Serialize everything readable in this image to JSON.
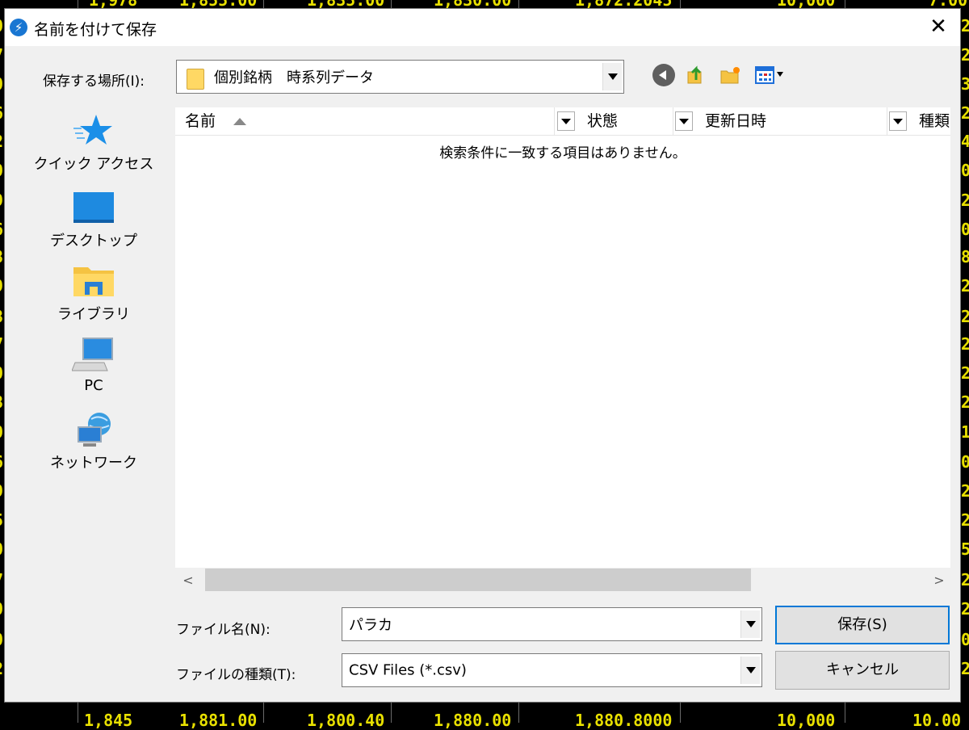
{
  "background": {
    "top_row": [
      "1,978",
      "1,855.00",
      "1,835.00",
      "1,830.00",
      "1,872.2045",
      "10,000",
      "7.00"
    ],
    "bottom_row": [
      "1,845",
      "1,881.00",
      "1,800.40",
      "1,880.00",
      "1,880.8000",
      "10,000",
      "10.00"
    ],
    "left_digits": [
      "0",
      "7",
      "0",
      "6",
      "2",
      "0",
      "9",
      "6",
      "8",
      "9",
      "8",
      "7",
      "0",
      "8",
      "0",
      "6",
      "9",
      "5",
      "0",
      "7",
      "0",
      "0",
      "2"
    ],
    "right_digits": [
      "2",
      "2",
      "3",
      "2",
      "4",
      "0",
      "2",
      "0",
      "8",
      "2",
      "2",
      "2",
      "2",
      "2",
      "1",
      "0",
      "2",
      "2",
      "5",
      "2",
      "2",
      "0",
      "2"
    ],
    "number_color": "#e8e000"
  },
  "dialog": {
    "title": "名前を付けて保存",
    "close_glyph": "✕",
    "location_label": "保存する場所(I):",
    "location_value": "個別銘柄　時系列データ",
    "places": [
      {
        "label": "クイック アクセス",
        "icon": "star-icon"
      },
      {
        "label": "デスクトップ",
        "icon": "desktop-icon"
      },
      {
        "label": "ライブラリ",
        "icon": "library-icon"
      },
      {
        "label": "PC",
        "icon": "pc-icon"
      },
      {
        "label": "ネットワーク",
        "icon": "network-icon"
      }
    ],
    "columns": [
      "名前",
      "状態",
      "更新日時",
      "種類"
    ],
    "empty_message": "検索条件に一致する項目はありません。",
    "filename_label": "ファイル名(N):",
    "filename_value": "パラカ",
    "filetype_label": "ファイルの種類(T):",
    "filetype_value": "CSV Files (*.csv)",
    "save_button": "保存(S)",
    "cancel_button": "キャンセル",
    "scroll_left": "<",
    "scroll_right": ">",
    "accent_color": "#0078d7"
  }
}
